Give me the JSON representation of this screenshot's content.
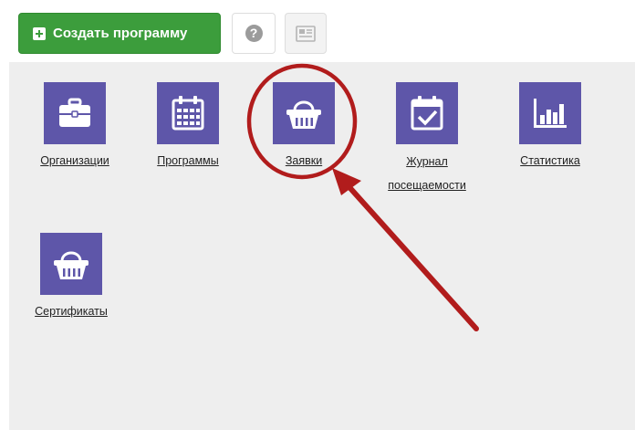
{
  "toolbar": {
    "create_label": "Создать программу",
    "help_symbol": "?"
  },
  "tiles": [
    {
      "label": "Организации",
      "icon": "briefcase-icon"
    },
    {
      "label": "Программы",
      "icon": "calendar-icon"
    },
    {
      "label": "Заявки",
      "icon": "basket-icon"
    },
    {
      "label_line1": "Журнал",
      "label_line2": "посещаемости",
      "icon": "calendar-check-icon"
    },
    {
      "label": "Статистика",
      "icon": "bar-chart-icon"
    },
    {
      "label": "Сертификаты",
      "icon": "basket-icon"
    }
  ],
  "colors": {
    "brand_green": "#3c9d3c",
    "tile_purple": "#5e56a9",
    "panel_bg": "#eeeeee",
    "annotation_red": "#b11c1c"
  }
}
